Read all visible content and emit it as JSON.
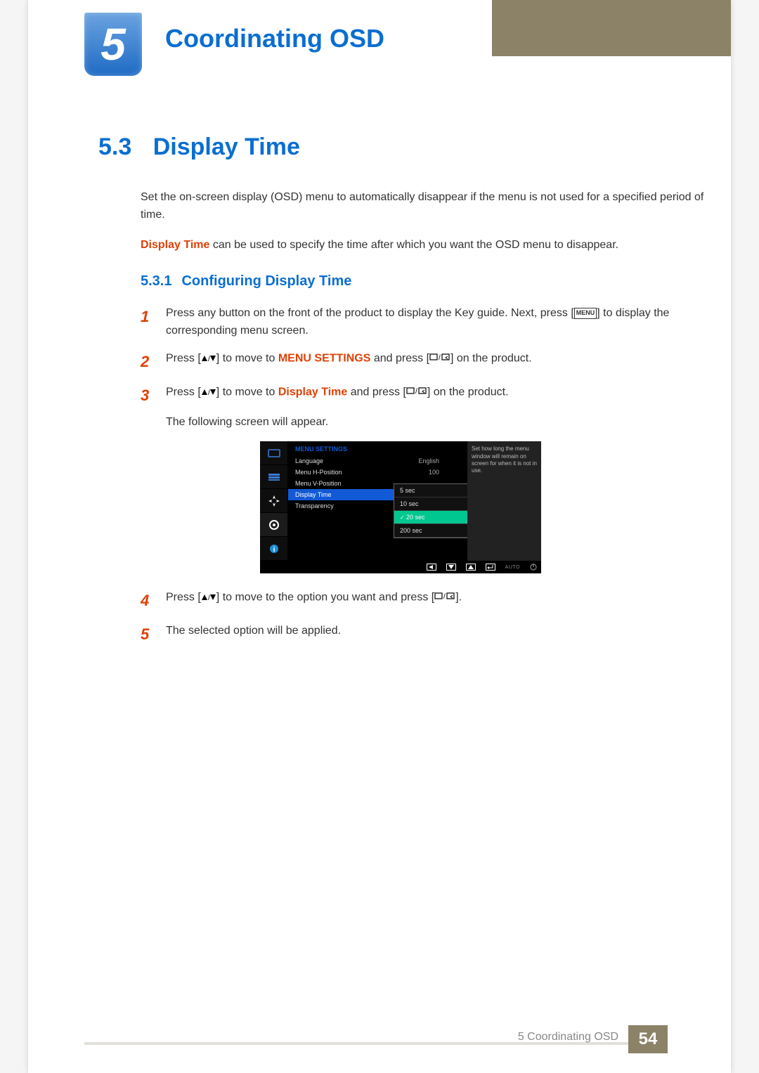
{
  "chapter": {
    "num": "5",
    "title": "Coordinating OSD"
  },
  "h2": {
    "num": "5.3",
    "title": "Display Time"
  },
  "intro1": "Set the on-screen display (OSD) menu to automatically disappear if the menu is not used for a specified period of time.",
  "intro2_bold": "Display Time",
  "intro2_rest": " can be used to specify the time after which you want the OSD menu to disappear.",
  "h3": {
    "num": "5.3.1",
    "title": "Configuring Display Time"
  },
  "steps": {
    "s1a": "Press any button on the front of the product to display the Key guide. Next, press [",
    "s1_menu": "MENU",
    "s1b": "] to display the corresponding menu screen.",
    "s2a": "Press [",
    "s2b": "] to move to ",
    "s2_bold": "MENU SETTINGS",
    "s2c": " and press [",
    "s2d": "] on the product.",
    "s3a": "Press [",
    "s3b": "] to move to ",
    "s3_bold": "Display Time",
    "s3c": " and press [",
    "s3d": "] on the product.",
    "s3_follow": "The following screen will appear.",
    "s4a": "Press [",
    "s4b": "] to move to the option you want and press [",
    "s4c": "].",
    "s5": "The selected option will be applied."
  },
  "step_nums": {
    "n1": "1",
    "n2": "2",
    "n3": "3",
    "n4": "4",
    "n5": "5"
  },
  "osd": {
    "title": "MENU SETTINGS",
    "rows": [
      {
        "label": "Language",
        "value": "English"
      },
      {
        "label": "Menu H-Position",
        "value": "100"
      },
      {
        "label": "Menu V-Position",
        "value": ""
      },
      {
        "label": "Display Time",
        "value": ""
      },
      {
        "label": "Transparency",
        "value": ""
      }
    ],
    "submenu": [
      "5 sec",
      "10 sec",
      "20 sec",
      "200 sec"
    ],
    "submenu_selected": "20 sec",
    "help": "Set how long the menu window will remain on screen for when it is not in use.",
    "auto_label": "AUTO"
  },
  "footer": {
    "text": "5 Coordinating OSD",
    "page": "54"
  },
  "chart_data": null
}
